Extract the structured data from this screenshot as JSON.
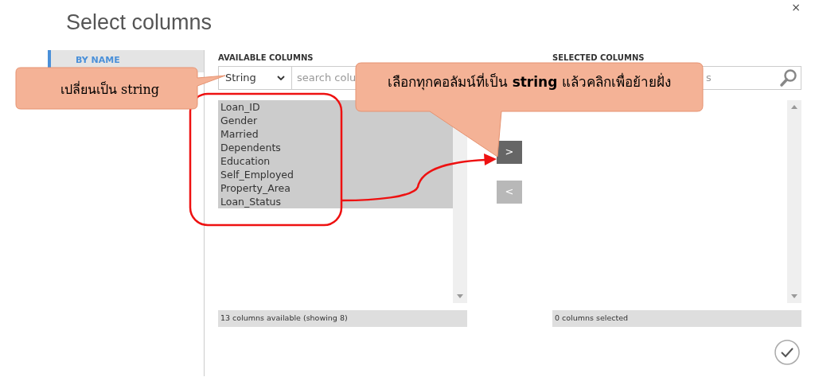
{
  "dialog": {
    "title": "Select columns",
    "close": "×"
  },
  "sidebar": {
    "items": [
      {
        "label": "BY NAME",
        "selected": true
      }
    ]
  },
  "available": {
    "heading": "AVAILABLE COLUMNS",
    "type_filter": "String",
    "search": {
      "placeholder": "search colu"
    },
    "items": [
      {
        "label": "Loan_ID",
        "selected": true
      },
      {
        "label": "Gender",
        "selected": true
      },
      {
        "label": "Married",
        "selected": true
      },
      {
        "label": "Dependents",
        "selected": true
      },
      {
        "label": "Education",
        "selected": true
      },
      {
        "label": "Self_Employed",
        "selected": true
      },
      {
        "label": "Property_Area",
        "selected": true
      },
      {
        "label": "Loan_Status",
        "selected": true
      }
    ],
    "status": "13 columns available (showing 8)"
  },
  "move_buttons": [
    {
      "label": ">",
      "disabled": false
    },
    {
      "label": "<",
      "disabled": true
    }
  ],
  "selected": {
    "heading": "SELECTED COLUMNS",
    "search": {
      "placeholder": "s"
    },
    "status": "0 columns selected"
  },
  "annotations": [
    {
      "text": "เปลี่ยนเป็น string"
    },
    {
      "text": "เลือกทุกคอลัมน์ที่เป็น **string** แล้วคลิกเพื่อย้ายฝั่ง"
    }
  ]
}
